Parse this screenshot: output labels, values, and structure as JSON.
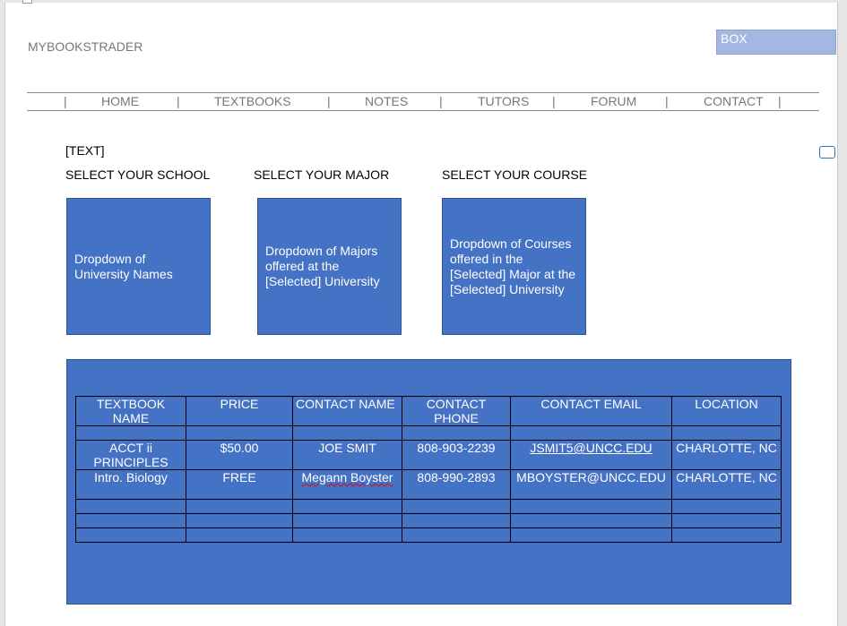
{
  "header": {
    "logo": "MYBOOKSTRADER",
    "box": "BOX"
  },
  "nav": {
    "separator": "|",
    "items": [
      "HOME",
      "TEXTBOOKS",
      "NOTES",
      "TUTORS",
      "FORUM",
      "CONTACT"
    ]
  },
  "content": {
    "placeholder": "[TEXT]",
    "selectors": [
      {
        "label": "SELECT YOUR SCHOOL",
        "box": "Dropdown of University Names"
      },
      {
        "label": "SELECT YOUR MAJOR",
        "box": "Dropdown of Majors offered at the [Selected] University"
      },
      {
        "label": "SELECT YOUR COURSE",
        "box": "Dropdown of Courses offered in the [Selected] Major at the [Selected] University"
      }
    ]
  },
  "table": {
    "headers": [
      "TEXTBOOK NAME",
      "PRICE",
      "CONTACT NAME",
      "CONTACT PHONE",
      "CONTACT EMAIL",
      "LOCATION"
    ],
    "rows": [
      [
        "",
        "",
        "",
        "",
        "",
        ""
      ],
      [
        "ACCT ii PRINCIPLES",
        "$50.00",
        "JOE SMIT",
        "808-903-2239",
        "JSMIT5@UNCC.EDU",
        "CHARLOTTE, NC"
      ],
      [
        "Intro. Biology",
        "FREE",
        "Megann Boyster",
        "808-990-2893",
        "MBOYSTER@UNCC.EDU",
        "CHARLOTTE, NC"
      ],
      [
        "",
        "",
        "",
        "",
        "",
        ""
      ],
      [
        "",
        "",
        "",
        "",
        "",
        ""
      ],
      [
        "",
        "",
        "",
        "",
        "",
        ""
      ]
    ]
  }
}
